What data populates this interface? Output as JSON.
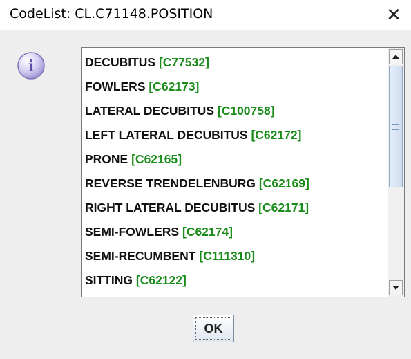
{
  "dialog": {
    "title": "CodeList: CL.C71148.POSITION",
    "close_glyph": "✕",
    "ok_label": "OK",
    "info_icon": "info-icon",
    "info_glyph": "i"
  },
  "list": {
    "items": [
      {
        "name": "DECUBITUS",
        "code": "[C77532]"
      },
      {
        "name": "FOWLERS",
        "code": "[C62173]"
      },
      {
        "name": "LATERAL DECUBITUS",
        "code": "[C100758]"
      },
      {
        "name": "LEFT LATERAL DECUBITUS",
        "code": "[C62172]"
      },
      {
        "name": "PRONE",
        "code": "[C62165]"
      },
      {
        "name": "REVERSE TRENDELENBURG",
        "code": "[C62169]"
      },
      {
        "name": "RIGHT LATERAL DECUBITUS",
        "code": "[C62171]"
      },
      {
        "name": "SEMI-FOWLERS",
        "code": "[C62174]"
      },
      {
        "name": "SEMI-RECUMBENT",
        "code": "[C111310]"
      },
      {
        "name": "SITTING",
        "code": "[C62122]"
      }
    ]
  },
  "colors": {
    "code_text": "#1a8c1a",
    "item_text": "#111111",
    "dialog_background": "#eeeeee"
  }
}
